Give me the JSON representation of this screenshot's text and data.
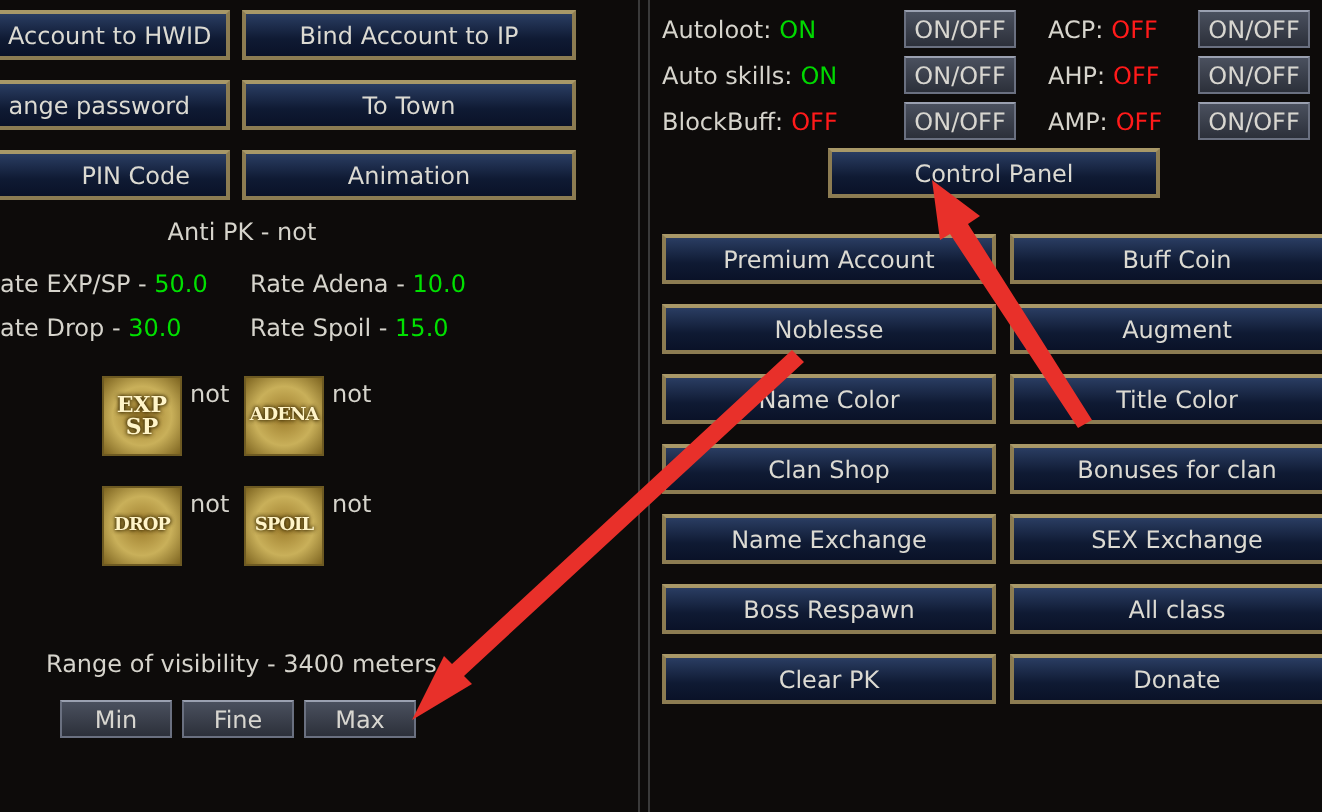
{
  "account_buttons": [
    {
      "label": "Account to HWID"
    },
    {
      "label": "Bind Account to IP"
    },
    {
      "label": "ange password"
    },
    {
      "label": "To Town"
    },
    {
      "label": "PIN Code"
    },
    {
      "label": "Animation"
    }
  ],
  "anti_pk": "Anti PK - not",
  "rates": [
    {
      "label": "ate EXP/SP - ",
      "value": "50.0"
    },
    {
      "label": "Rate Adena - ",
      "value": "10.0"
    },
    {
      "label": "ate Drop - ",
      "value": "30.0"
    },
    {
      "label": "Rate Spoil - ",
      "value": "15.0"
    }
  ],
  "bonuses": [
    {
      "lines": [
        "EXP",
        "SP"
      ],
      "status": "not"
    },
    {
      "lines": [
        "ADENA"
      ],
      "status": "not"
    },
    {
      "lines": [
        "DROP"
      ],
      "status": "not"
    },
    {
      "lines": [
        "SPOIL"
      ],
      "status": "not"
    }
  ],
  "visibility": {
    "text": "Range of visibility - 3400 meters",
    "buttons": [
      "Min",
      "Fine",
      "Max"
    ]
  },
  "toggles": [
    {
      "label": "Autoloot:",
      "value": "ON",
      "on": true,
      "button": "ON/OFF"
    },
    {
      "label": "ACP:",
      "value": "OFF",
      "on": false,
      "button": "ON/OFF"
    },
    {
      "label": "Auto skills:",
      "value": "ON",
      "on": true,
      "button": "ON/OFF"
    },
    {
      "label": "AHP:",
      "value": "OFF",
      "on": false,
      "button": "ON/OFF"
    },
    {
      "label": "BlockBuff:",
      "value": "OFF",
      "on": false,
      "button": "ON/OFF"
    },
    {
      "label": "AMP:",
      "value": "OFF",
      "on": false,
      "button": "ON/OFF"
    }
  ],
  "control_panel": "Control Panel",
  "menu_buttons": [
    "Premium Account",
    "Buff Coin",
    "Noblesse",
    "Augment",
    "Name Color",
    "Title Color",
    "Clan Shop",
    "Bonuses for clan",
    "Name Exchange",
    "SEX Exchange",
    "Boss Respawn",
    "All class",
    "Clear PK",
    "Donate"
  ]
}
